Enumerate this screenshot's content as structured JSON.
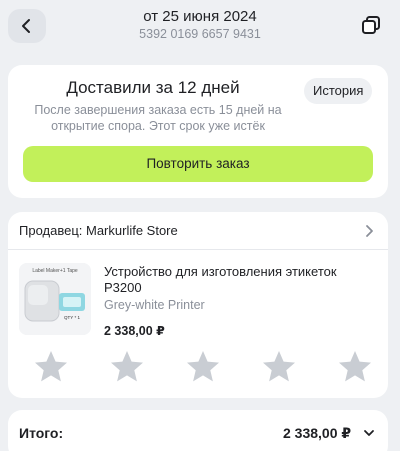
{
  "header": {
    "title": "от 25 июня 2024",
    "order_number": "5392 0169 6657 9431",
    "back_icon": "chevron-left-icon",
    "copy_icon": "copy-icon"
  },
  "delivery": {
    "title": "Доставили за 12 дней",
    "history_label": "История",
    "note": "После завершения заказа есть 15 дней на открытие спора. Этот срок уже истёк",
    "repeat_label": "Повторить заказ",
    "accent_color": "#c2f05a"
  },
  "seller": {
    "label": "Продавец: Markurlife Store"
  },
  "product": {
    "name": "Устройство для изготовления этикеток P3200",
    "variant": "Grey-white Printer",
    "price": "2 338,00 ₽",
    "image_caption": "Label Maker+1 Tape",
    "image_tag": "QTY * 1",
    "rating": 0,
    "rating_max": 5
  },
  "total": {
    "label": "Итого:",
    "value": "2 338,00 ₽"
  }
}
